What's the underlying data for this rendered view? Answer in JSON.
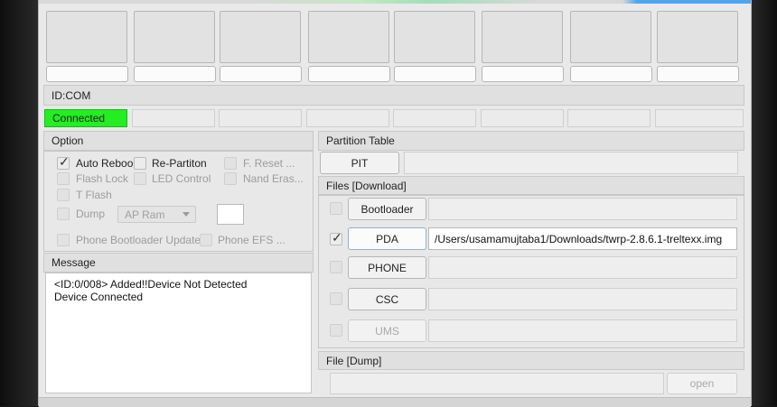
{
  "id_com": {
    "header": "ID:COM",
    "status": "Connected"
  },
  "option": {
    "header": "Option",
    "items": [
      {
        "label": "Auto Reboot",
        "checked": true,
        "enabled": true
      },
      {
        "label": "Re-Partiton",
        "checked": false,
        "enabled": true
      },
      {
        "label": "F. Reset ...",
        "checked": false,
        "enabled": false
      },
      {
        "label": "Flash Lock",
        "checked": false,
        "enabled": false
      },
      {
        "label": "LED Control",
        "checked": false,
        "enabled": false
      },
      {
        "label": "Nand Eras...",
        "checked": false,
        "enabled": false
      },
      {
        "label": "T Flash",
        "checked": false,
        "enabled": false
      },
      {
        "label": "Dump",
        "checked": false,
        "enabled": false
      },
      {
        "label": "Phone Bootloader Update",
        "checked": false,
        "enabled": false
      },
      {
        "label": "Phone EFS ...",
        "checked": false,
        "enabled": false
      }
    ],
    "dump_select": "AP Ram"
  },
  "message": {
    "header": "Message",
    "lines": [
      "<ID:0/008> Added!!Device Not Detected",
      "Device Connected"
    ]
  },
  "partition_table": {
    "header": "Partition Table",
    "pit_button": "PIT",
    "pit_path": ""
  },
  "files_download": {
    "header": "Files [Download]",
    "rows": [
      {
        "button": "Bootloader",
        "checked": false,
        "path": "",
        "enabled": true
      },
      {
        "button": "PDA",
        "checked": true,
        "path": "/Users/usamamujtaba1/Downloads/twrp-2.8.6.1-treltexx.img",
        "enabled": true
      },
      {
        "button": "PHONE",
        "checked": false,
        "path": "",
        "enabled": true
      },
      {
        "button": "CSC",
        "checked": false,
        "path": "",
        "enabled": true
      },
      {
        "button": "UMS",
        "checked": false,
        "path": "",
        "enabled": false
      }
    ]
  },
  "file_dump": {
    "header": "File [Dump]",
    "open_button": "open"
  },
  "colors": {
    "connected": "#22ee22",
    "window": "#e9e9e9"
  }
}
